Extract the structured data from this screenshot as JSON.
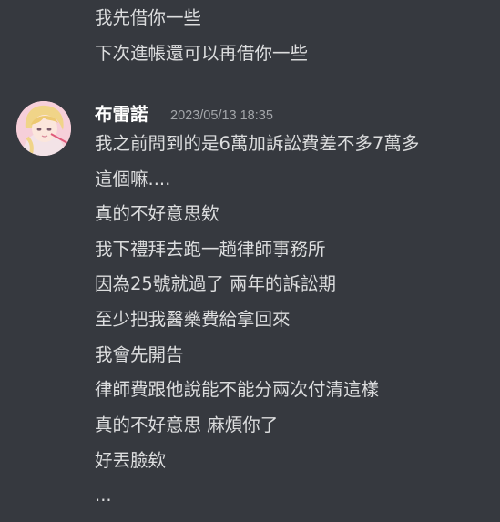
{
  "previous_message": {
    "lines": [
      "我先借你一些",
      "下次進帳還可以再借你一些"
    ]
  },
  "message": {
    "author": "布雷諾",
    "timestamp": "2023/05/13 18:35",
    "lines": [
      "我之前問到的是6萬加訴訟費差不多7萬多",
      "這個嘛....",
      "真的不好意思欸",
      "我下禮拜去跑一趟律師事務所",
      "因為25號就過了 兩年的訴訟期",
      "至少把我醫藥費給拿回來",
      "我會先開告",
      "律師費跟他說能不能分兩次付清這樣",
      "真的不好意思 麻煩你了",
      "好丟臉欸",
      "..."
    ]
  }
}
